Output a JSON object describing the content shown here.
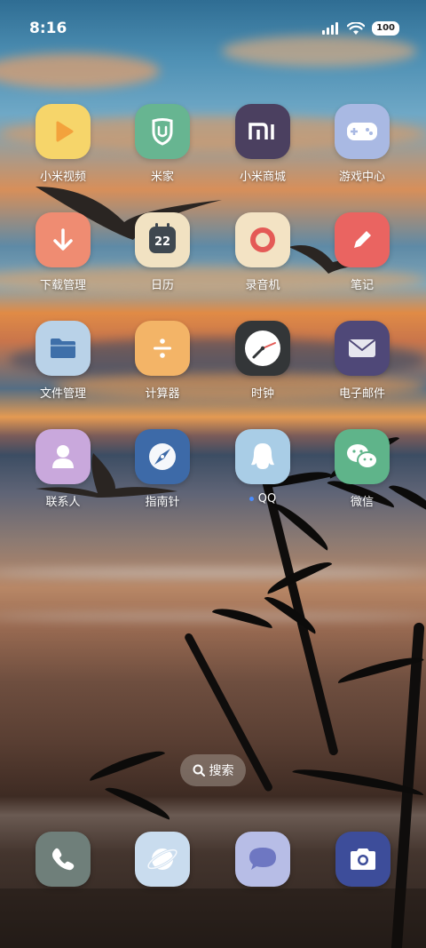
{
  "status_bar": {
    "time": "8:16",
    "battery": "100",
    "signal_icon": "cellular-signal-icon",
    "wifi_icon": "wifi-icon"
  },
  "apps": [
    {
      "label": "小米视频",
      "icon": "play-icon",
      "bg": "#f6d56a",
      "fg": "#f3a23c"
    },
    {
      "label": "米家",
      "icon": "mijia-shield-icon",
      "bg": "#67b591",
      "fg": "#ffffff"
    },
    {
      "label": "小米商城",
      "icon": "mi-logo-icon",
      "bg": "#4b4060",
      "fg": "#ffffff"
    },
    {
      "label": "游戏中心",
      "icon": "gamepad-icon",
      "bg": "#a9b9e3",
      "fg": "#ffffff"
    },
    {
      "label": "下载管理",
      "icon": "download-arrow-icon",
      "bg": "#ef8c72",
      "fg": "#ffffff"
    },
    {
      "label": "日历",
      "icon": "calendar-icon",
      "bg": "#f1e2c2",
      "fg": "#3f4850",
      "badge": "22"
    },
    {
      "label": "录音机",
      "icon": "record-ring-icon",
      "bg": "#f3e3c4",
      "fg": "#e45a56"
    },
    {
      "label": "笔记",
      "icon": "pencil-icon",
      "bg": "#ea6461",
      "fg": "#ffffff"
    },
    {
      "label": "文件管理",
      "icon": "folder-icon",
      "bg": "#b9d2e8",
      "fg": "#3e6fa9"
    },
    {
      "label": "计算器",
      "icon": "divide-icon",
      "bg": "#f3b467",
      "fg": "#ffffff"
    },
    {
      "label": "时钟",
      "icon": "clock-icon",
      "bg": "#333638",
      "fg": "#ffffff"
    },
    {
      "label": "电子邮件",
      "icon": "envelope-icon",
      "bg": "#4f4878",
      "fg": "#e6e6ee"
    },
    {
      "label": "联系人",
      "icon": "person-icon",
      "bg": "#c9a8dc",
      "fg": "#ffffff"
    },
    {
      "label": "指南针",
      "icon": "compass-icon",
      "bg": "#3d6aa8",
      "fg": "#ffffff"
    },
    {
      "label": "QQ",
      "icon": "qq-penguin-icon",
      "bg": "#a9cde6",
      "fg": "#ffffff",
      "dot": true
    },
    {
      "label": "微信",
      "icon": "wechat-bubbles-icon",
      "bg": "#5fb48a",
      "fg": "#ffffff"
    }
  ],
  "search": {
    "label": "搜索",
    "icon": "search-icon"
  },
  "dock": [
    {
      "name": "phone",
      "icon": "phone-handset-icon",
      "bg": "#6f7f7a"
    },
    {
      "name": "browser",
      "icon": "planet-icon",
      "bg": "#c9dcee"
    },
    {
      "name": "messages",
      "icon": "chat-bubble-icon",
      "bg": "#b7bde6"
    },
    {
      "name": "camera",
      "icon": "camera-icon",
      "bg": "#3d4d9a"
    }
  ]
}
